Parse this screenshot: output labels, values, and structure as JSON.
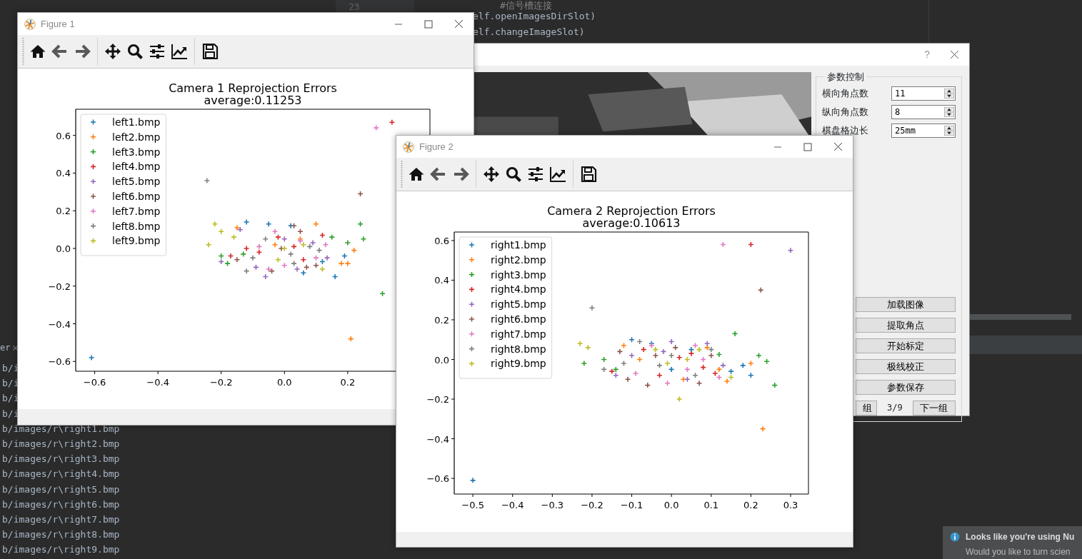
{
  "editor": {
    "line_number": "23",
    "lines": [
      {
        "kind": "comment",
        "text": "#信号槽连接"
      },
      {
        "kind": "code",
        "text": "elf.openImagesDirSlot)"
      },
      {
        "kind": "code",
        "text": "elf.changeImageSlot)"
      }
    ]
  },
  "terminal": {
    "tab": "er",
    "lines": [
      "b/i",
      "b/i",
      "b/i",
      "b/i",
      "b/images/r\\right1.bmp",
      "b/images/r\\right2.bmp",
      "b/images/r\\right3.bmp",
      "b/images/r\\right4.bmp",
      "b/images/r\\right5.bmp",
      "b/images/r\\right6.bmp",
      "b/images/r\\right7.bmp",
      "b/images/r\\right8.bmp",
      "b/images/r\\right9.bmp"
    ]
  },
  "calibration_dialog": {
    "help": "?",
    "group_title": "参数控制",
    "fields": [
      {
        "label": "横向角点数",
        "value": "11"
      },
      {
        "label": "纵向角点数",
        "value": "8"
      },
      {
        "label": "棋盘格边长",
        "value": "25mm"
      }
    ],
    "buttons": [
      "加载图像",
      "提取角点",
      "开始标定",
      "极线校正",
      "参数保存"
    ],
    "prev_button": "组",
    "page": "3/9",
    "next_button": "下一组"
  },
  "figures": [
    {
      "title": "Figure 1",
      "subtitle": "average:0.11253",
      "chart_data": {
        "type": "scatter",
        "title": "Camera 1 Reprojection Errors",
        "legend": "upper left",
        "xlim": [
          -0.66,
          0.46
        ],
        "ylim": [
          -0.652,
          0.739
        ],
        "xticks": [
          {
            "value": -0.6,
            "label": "−0.6"
          },
          {
            "value": -0.4,
            "label": "−0.4"
          },
          {
            "value": -0.2,
            "label": "−0.2"
          },
          {
            "value": 0,
            "label": "0.0"
          },
          {
            "value": 0.2,
            "label": "0.2"
          }
        ],
        "yticks": [
          {
            "value": -0.6,
            "label": "−0.6"
          },
          {
            "value": -0.4,
            "label": "−0.4"
          },
          {
            "value": -0.2,
            "label": "−0.2"
          },
          {
            "value": 0,
            "label": "0.0"
          },
          {
            "value": 0.2,
            "label": "0.2"
          },
          {
            "value": 0.4,
            "label": "0.4"
          },
          {
            "value": 0.6,
            "label": "0.6"
          }
        ],
        "series": [
          {
            "name": "left1.bmp",
            "color": "#1f77b4",
            "x": [
              -0.61,
              -0.12,
              0.12,
              0.16,
              -0.05,
              0.02,
              0.19,
              0.06
            ],
            "values": [
              -0.58,
              0.14,
              -0.07,
              -0.15,
              0.13,
              0.12,
              -0.04,
              -0.13
            ]
          },
          {
            "name": "left2.bmp",
            "color": "#ff7f0e",
            "x": [
              0.21,
              0.2,
              0.18,
              0.1,
              -0.15,
              0.22,
              -0.03,
              0.05
            ],
            "values": [
              -0.48,
              -0.08,
              -0.08,
              0.13,
              0.11,
              -0.01,
              0.02,
              0.05
            ]
          },
          {
            "name": "left3.bmp",
            "color": "#2ca02c",
            "x": [
              0.31,
              0.24,
              0.25,
              0.2,
              -0.2,
              -0.13,
              0.15,
              -0.18
            ],
            "values": [
              -0.24,
              0.13,
              0.05,
              0.03,
              -0.04,
              -0.03,
              0.06,
              -0.08
            ]
          },
          {
            "name": "left4.bmp",
            "color": "#d62728",
            "x": [
              0.34,
              -0.17,
              0.03,
              -0.08,
              0.12,
              -0.02,
              0.06,
              -0.12
            ],
            "values": [
              0.67,
              -0.04,
              0.01,
              -0.02,
              0.07,
              0.06,
              -0.06,
              0.0
            ]
          },
          {
            "name": "left5.bmp",
            "color": "#9467bd",
            "x": [
              -0.2,
              -0.06,
              0.135,
              -0.14,
              0.0,
              0.04,
              -0.09,
              0.09
            ],
            "values": [
              -0.07,
              -0.15,
              -0.05,
              0.1,
              0.05,
              -0.11,
              -0.1,
              0.03
            ]
          },
          {
            "name": "left6.bmp",
            "color": "#8c564b",
            "x": [
              0.24,
              0.03,
              -0.04,
              0.07,
              -0.01,
              -0.15,
              0.05,
              0.1
            ],
            "values": [
              0.29,
              0.12,
              -0.12,
              -0.1,
              0.0,
              -0.06,
              0.09,
              -0.09
            ]
          },
          {
            "name": "left7.bmp",
            "color": "#e377c2",
            "x": [
              0.29,
              -0.03,
              0.0,
              0.05,
              -0.08,
              0.1,
              -0.05,
              0.13
            ],
            "values": [
              0.64,
              0.09,
              -0.09,
              0.04,
              0.01,
              -0.05,
              -0.11,
              0.02
            ]
          },
          {
            "name": "left8.bmp",
            "color": "#7f7f7f",
            "x": [
              -0.245,
              -0.12,
              0.02,
              -0.06,
              0.08,
              0.03,
              -0.1,
              0.11
            ],
            "values": [
              0.36,
              -0.12,
              -0.03,
              0.05,
              0.01,
              -0.08,
              -0.05,
              -0.01
            ]
          },
          {
            "name": "left9.bmp",
            "color": "#bcbd22",
            "x": [
              -0.24,
              -0.22,
              -0.2,
              0.0,
              0.06,
              -0.02,
              0.12,
              -0.16
            ],
            "values": [
              0.02,
              0.13,
              0.09,
              0.0,
              0.02,
              -0.06,
              -0.11,
              0.06
            ]
          }
        ]
      }
    },
    {
      "title": "Figure 2",
      "subtitle": "average:0.10613",
      "chart_data": {
        "type": "scatter",
        "title": "Camera 2 Reprojection Errors",
        "legend": "upper left",
        "xlim": [
          -0.547,
          0.345
        ],
        "ylim": [
          -0.679,
          0.643
        ],
        "xticks": [
          {
            "value": -0.5,
            "label": "−0.5"
          },
          {
            "value": -0.4,
            "label": "−0.4"
          },
          {
            "value": -0.3,
            "label": "−0.3"
          },
          {
            "value": -0.2,
            "label": "−0.2"
          },
          {
            "value": -0.1,
            "label": "−0.1"
          },
          {
            "value": 0,
            "label": "0.0"
          },
          {
            "value": 0.1,
            "label": "0.1"
          },
          {
            "value": 0.2,
            "label": "0.2"
          },
          {
            "value": 0.3,
            "label": "0.3"
          }
        ],
        "yticks": [
          {
            "value": -0.6,
            "label": "−0.6"
          },
          {
            "value": -0.4,
            "label": "−0.4"
          },
          {
            "value": -0.2,
            "label": "−0.2"
          },
          {
            "value": 0,
            "label": "0.0"
          },
          {
            "value": 0.2,
            "label": "0.2"
          },
          {
            "value": 0.4,
            "label": "0.4"
          },
          {
            "value": 0.6,
            "label": "0.6"
          }
        ],
        "series": [
          {
            "name": "right1.bmp",
            "color": "#1f77b4",
            "x": [
              -0.5,
              0.2,
              0.15,
              -0.1,
              0.05,
              0.18,
              0.0,
              -0.05
            ],
            "values": [
              -0.61,
              -0.08,
              -0.06,
              0.1,
              0.05,
              -0.03,
              -0.05,
              0.08
            ]
          },
          {
            "name": "right2.bmp",
            "color": "#ff7f0e",
            "x": [
              0.23,
              0.14,
              0.12,
              -0.12,
              0.03,
              -0.08,
              0.09,
              0.2
            ],
            "values": [
              -0.35,
              -0.11,
              -0.05,
              0.07,
              -0.1,
              0.0,
              0.06,
              -0.02
            ]
          },
          {
            "name": "right3.bmp",
            "color": "#2ca02c",
            "x": [
              0.26,
              0.22,
              0.24,
              -0.22,
              -0.17,
              0.16,
              -0.14,
              0.12
            ],
            "values": [
              -0.13,
              0.02,
              -0.01,
              -0.02,
              0.0,
              0.13,
              -0.05,
              0.025
            ]
          },
          {
            "name": "right4.bmp",
            "color": "#d62728",
            "x": [
              0.2,
              -0.15,
              0.05,
              -0.03,
              0.11,
              -0.07,
              0.02,
              0.08
            ],
            "values": [
              0.58,
              -0.06,
              0.03,
              -0.08,
              -0.07,
              0.05,
              0.01,
              -0.04
            ]
          },
          {
            "name": "right5.bmp",
            "color": "#9467bd",
            "x": [
              0.3,
              -0.14,
              0.09,
              -0.02,
              0.04,
              -0.1,
              0.13,
              0.0
            ],
            "values": [
              0.55,
              -0.08,
              0.08,
              0.04,
              -0.1,
              0.02,
              -0.03,
              0.09
            ]
          },
          {
            "name": "right6.bmp",
            "color": "#8c564b",
            "x": [
              0.225,
              -0.06,
              0.07,
              -0.11,
              0.01,
              -0.04,
              0.1,
              -0.13
            ],
            "values": [
              0.35,
              -0.13,
              -0.12,
              -0.1,
              0.06,
              0.02,
              0.02,
              0.04
            ]
          },
          {
            "name": "right7.bmp",
            "color": "#e377c2",
            "x": [
              0.13,
              -0.05,
              0.04,
              -0.09,
              0.08,
              -0.01,
              0.06,
              0.12
            ],
            "values": [
              0.58,
              0.07,
              -0.05,
              -0.07,
              0.0,
              -0.12,
              0.07,
              -0.09
            ]
          },
          {
            "name": "right8.bmp",
            "color": "#7f7f7f",
            "x": [
              -0.2,
              -0.17,
              -0.08,
              0.0,
              0.06,
              -0.03,
              0.1,
              -0.12
            ],
            "values": [
              0.26,
              -0.05,
              0.09,
              0.02,
              -0.08,
              -0.03,
              0.05,
              -0.02
            ]
          },
          {
            "name": "right9.bmp",
            "color": "#bcbd22",
            "x": [
              -0.23,
              -0.21,
              0.02,
              0.04,
              -0.04,
              0.07,
              0.15,
              -0.01
            ],
            "values": [
              0.08,
              0.06,
              -0.2,
              0.0,
              0.05,
              0.05,
              -0.09,
              -0.02
            ]
          }
        ]
      }
    }
  ],
  "notification": {
    "title": "Looks like you're using Nu",
    "message": "Would you like to turn scien"
  }
}
